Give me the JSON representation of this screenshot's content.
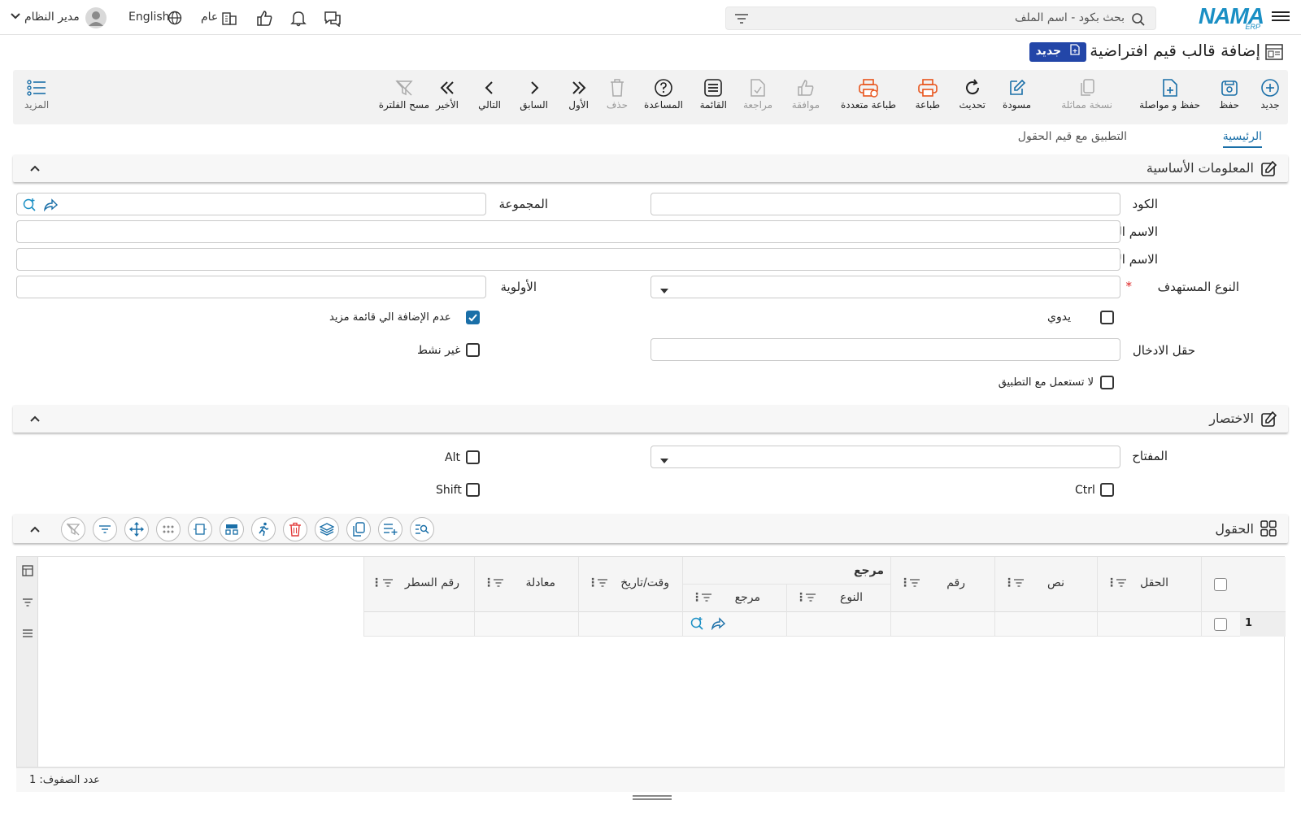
{
  "topbar": {
    "logo": "NAMA",
    "logo_sub": "ERP",
    "search_placeholder": "بحث بكود - اسم الملف",
    "user": "مدير النظام",
    "language": "English",
    "branch": "عام"
  },
  "page": {
    "title": "إضافة قالب قيم افتراضية",
    "new_badge": "جديد"
  },
  "toolbar": {
    "new": "جديد",
    "save": "حفظ",
    "save_continue": "حفظ و مواصلة",
    "duplicate": "نسخة مماثلة",
    "draft": "مسودة",
    "refresh": "تحديث",
    "print": "طباعة",
    "multi_print": "طباعة متعددة",
    "approve": "موافقة",
    "review": "مراجعة",
    "list": "القائمة",
    "help": "المساعدة",
    "delete": "حذف",
    "first": "الأول",
    "prev": "السابق",
    "next": "التالي",
    "last": "الأخير",
    "clear_filter": "مسح الفلترة",
    "more": "المزيد"
  },
  "tabs": {
    "main": "الرئيسية",
    "apply": "التطبيق مع قيم الحقول"
  },
  "basic": {
    "title": "المعلومات الأساسية",
    "code": "الكود",
    "group": "المجموعة",
    "arabic_name": "الاسم العربي",
    "english_name": "الاسم الإنجليزي",
    "target_type": "النوع المستهدف",
    "required_mark": "*",
    "priority": "الأولوية",
    "manual": "يدوي",
    "no_add_more": "عدم الإضافة الي قائمة مزيد",
    "input_field": "حقل الادخال",
    "inactive": "غير نشط",
    "not_used_apply": "لا تستعمل مع التطبيق"
  },
  "shortcut": {
    "title": "الاختصار",
    "key": "المفتاح",
    "alt": "Alt",
    "ctrl": "Ctrl",
    "shift": "Shift"
  },
  "fields": {
    "title": "الحقول",
    "columns": {
      "field": "الحقل",
      "text": "نص",
      "number": "رقم",
      "ref_group": "مرجع",
      "type": "النوع",
      "ref": "مرجع",
      "datetime": "وقت/تاريخ",
      "formula": "معادلة",
      "line_no": "رقم السطر"
    },
    "rows": [
      {
        "index": "1"
      }
    ],
    "row_count": "عدد الصفوف: 1"
  },
  "colors": {
    "accent": "#1a6fa8",
    "badge": "#2346a8",
    "print_orange": "#e8541c"
  }
}
